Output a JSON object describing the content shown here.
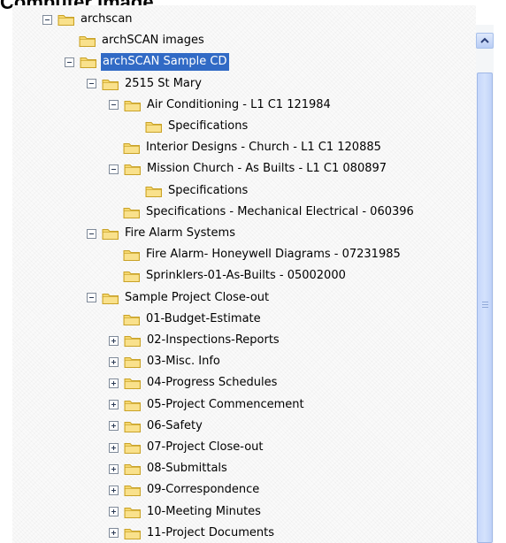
{
  "heading": "Computer image",
  "tree": {
    "nodes": [
      {
        "label": "archscan",
        "expander": "minus",
        "level": 0,
        "selected": false
      },
      {
        "label": "archSCAN images",
        "expander": "none",
        "level": 1,
        "selected": false
      },
      {
        "label": "archSCAN Sample CD",
        "expander": "minus",
        "level": 1,
        "selected": true
      },
      {
        "label": "2515 St Mary",
        "expander": "minus",
        "level": 2,
        "selected": false
      },
      {
        "label": "Air Conditioning - L1 C1 121984",
        "expander": "minus",
        "level": 3,
        "selected": false
      },
      {
        "label": "Specifications",
        "expander": "none",
        "level": 4,
        "selected": false
      },
      {
        "label": "Interior Designs - Church - L1 C1 120885",
        "expander": "none",
        "level": 3,
        "selected": false
      },
      {
        "label": "Mission Church - As Builts - L1 C1 080897",
        "expander": "minus",
        "level": 3,
        "selected": false
      },
      {
        "label": "Specifications",
        "expander": "none",
        "level": 4,
        "selected": false
      },
      {
        "label": "Specifications - Mechanical Electrical - 060396",
        "expander": "none",
        "level": 3,
        "selected": false
      },
      {
        "label": "Fire Alarm Systems",
        "expander": "minus",
        "level": 2,
        "selected": false
      },
      {
        "label": "Fire Alarm- Honeywell Diagrams - 07231985",
        "expander": "none",
        "level": 3,
        "selected": false
      },
      {
        "label": "Sprinklers-01-As-Builts - 05002000",
        "expander": "none",
        "level": 3,
        "selected": false
      },
      {
        "label": "Sample Project Close-out",
        "expander": "minus",
        "level": 2,
        "selected": false
      },
      {
        "label": "01-Budget-Estimate",
        "expander": "none",
        "level": 3,
        "selected": false
      },
      {
        "label": "02-Inspections-Reports",
        "expander": "plus",
        "level": 3,
        "selected": false
      },
      {
        "label": "03-Misc. Info",
        "expander": "plus",
        "level": 3,
        "selected": false
      },
      {
        "label": "04-Progress Schedules",
        "expander": "plus",
        "level": 3,
        "selected": false
      },
      {
        "label": "05-Project Commencement",
        "expander": "plus",
        "level": 3,
        "selected": false
      },
      {
        "label": "06-Safety",
        "expander": "plus",
        "level": 3,
        "selected": false
      },
      {
        "label": "07-Project Close-out",
        "expander": "plus",
        "level": 3,
        "selected": false
      },
      {
        "label": "08-Submittals",
        "expander": "plus",
        "level": 3,
        "selected": false
      },
      {
        "label": "09-Correspondence",
        "expander": "plus",
        "level": 3,
        "selected": false
      },
      {
        "label": "10-Meeting Minutes",
        "expander": "plus",
        "level": 3,
        "selected": false
      },
      {
        "label": "11-Project Documents",
        "expander": "plus",
        "level": 3,
        "selected": false
      }
    ]
  },
  "icons": {
    "folder": "folder-icon",
    "scroll_up": "chevron-up-icon"
  },
  "colors": {
    "selection": "#316ac5",
    "folder_fill": "#f5d76e",
    "folder_stroke": "#c9a227"
  }
}
